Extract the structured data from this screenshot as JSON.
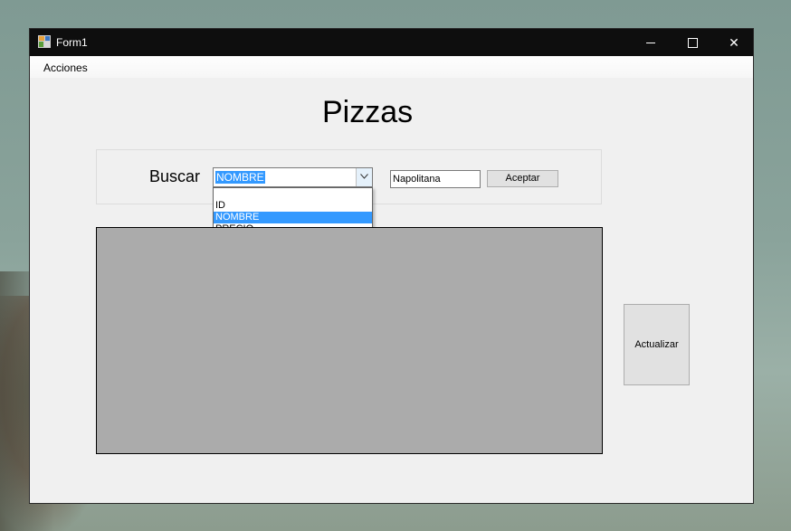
{
  "window": {
    "title": "Form1",
    "controls": {
      "minimize": "minimize",
      "maximize": "maximize",
      "close": "✕"
    }
  },
  "menu": {
    "items": [
      "Acciones"
    ]
  },
  "main": {
    "heading": "Pizzas",
    "search": {
      "label": "Buscar",
      "combo_value": "NOMBRE",
      "options": [
        "ID",
        "NOMBRE",
        "PRECIO"
      ],
      "selected_index": 1,
      "text_value": "Napolitana",
      "accept_label": "Aceptar"
    },
    "refresh_label": "Actualizar"
  },
  "colors": {
    "selection": "#3399ff",
    "grid_bg": "#ababab",
    "titlebar": "#0e0e0e"
  }
}
